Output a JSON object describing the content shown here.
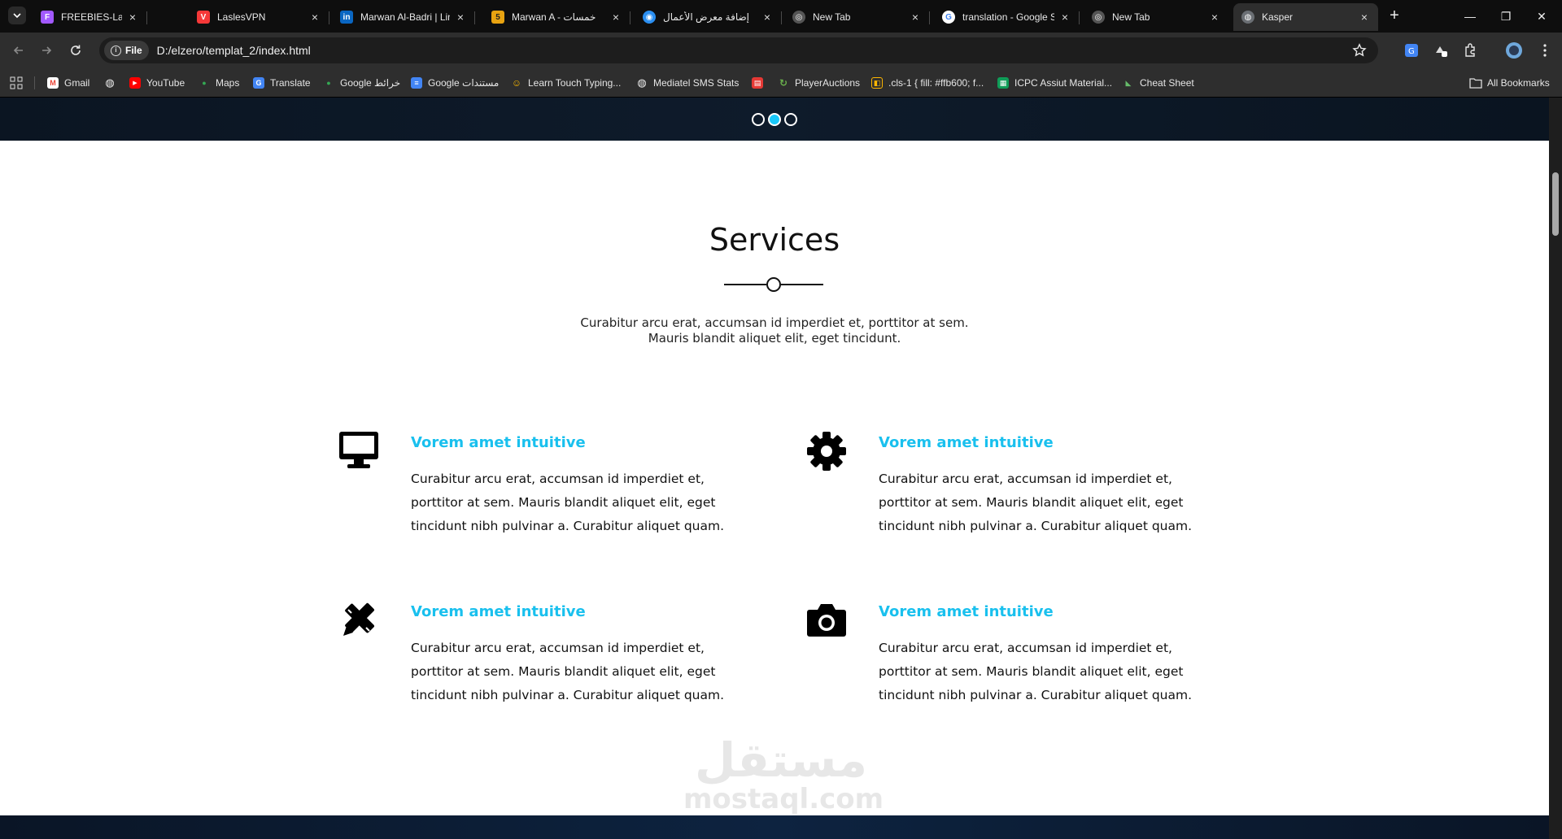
{
  "browser": {
    "tabs": [
      {
        "title": "FREEBIES-Landingpage",
        "favicon": "figma-icon",
        "color": "#a259ff",
        "glyph": "F"
      },
      {
        "title": "LaslesVPN",
        "favicon": "vpn-icon",
        "color": "#f53838",
        "glyph": "V"
      },
      {
        "title": "Marwan Al-Badri | Lin",
        "favicon": "linkedin-icon",
        "color": "#0a66c2",
        "glyph": "in"
      },
      {
        "title": "Marwan A - خمسات",
        "favicon": "khamsat-icon",
        "color": "#e8a311",
        "glyph": "5"
      },
      {
        "title": "إضافة معرض الأعمال",
        "favicon": "mostaql-icon",
        "color": "#2b8ff1",
        "glyph": "◉"
      },
      {
        "title": "New Tab",
        "favicon": "chrome-icon",
        "color": "#cccccc",
        "glyph": "◎"
      },
      {
        "title": "translation - Google S",
        "favicon": "google-icon",
        "color": "#4285f4",
        "glyph": "G"
      },
      {
        "title": "New Tab",
        "favicon": "chrome-icon",
        "color": "#cccccc",
        "glyph": "◎"
      },
      {
        "title": "Kasper",
        "favicon": "globe-icon",
        "color": "#9aa0a6",
        "glyph": "◍"
      }
    ],
    "address": {
      "chip": "File",
      "url": "D:/elzero/templat_2/index.html"
    },
    "bookmarks": [
      {
        "label": "Gmail",
        "icon": "gmail-icon",
        "color": "#ea4335",
        "glyph": "M"
      },
      {
        "label": "",
        "icon": "globe-icon",
        "color": "#e8e8e8",
        "glyph": "◍"
      },
      {
        "label": "YouTube",
        "icon": "youtube-icon",
        "color": "#ff0000",
        "glyph": "▶"
      },
      {
        "label": "Maps",
        "icon": "maps-icon",
        "color": "#34a853",
        "glyph": "●"
      },
      {
        "label": "Translate",
        "icon": "translate-icon",
        "color": "#4285f4",
        "glyph": "G"
      },
      {
        "label": "Google خرائط",
        "icon": "maps-icon",
        "color": "#34a853",
        "glyph": "●"
      },
      {
        "label": "Google مستندات",
        "icon": "docs-icon",
        "color": "#4285f4",
        "glyph": "≡"
      },
      {
        "label": "Learn Touch Typing...",
        "icon": "typing-icon",
        "color": "#f4b400",
        "glyph": "☺"
      },
      {
        "label": "Mediatel SMS Stats",
        "icon": "globe-icon",
        "color": "#e8e8e8",
        "glyph": "◍"
      },
      {
        "label": "",
        "icon": "red-box-icon",
        "color": "#e53935",
        "glyph": "▤"
      },
      {
        "label": "PlayerAuctions",
        "icon": "playerauctions-icon",
        "color": "#6ab04c",
        "glyph": "↻"
      },
      {
        "label": ".cls-1 { fill: #ffb600; f...",
        "icon": "css-icon",
        "color": "#ffb600",
        "glyph": "◧"
      },
      {
        "label": "ICPC Assiut Material...",
        "icon": "sheets-icon",
        "color": "#0f9d58",
        "glyph": "▦"
      },
      {
        "label": "Cheat Sheet",
        "icon": "cheatsheet-icon",
        "color": "#66bb6a",
        "glyph": "◣"
      }
    ],
    "all_bookmarks": "All Bookmarks"
  },
  "page": {
    "slider_bullets": 3,
    "active_bullet": 1,
    "services": {
      "title": "Services",
      "description_line1": "Curabitur arcu erat, accumsan id imperdiet et, porttitor at sem.",
      "description_line2": "Mauris blandit aliquet elit, eget tincidunt.",
      "items": [
        {
          "icon": "desktop-icon",
          "heading": "Vorem amet intuitive",
          "text": "Curabitur arcu erat, accumsan id imperdiet et, porttitor at sem. Mauris blandit aliquet elit, eget tincidunt nibh pulvinar a. Curabitur aliquet quam."
        },
        {
          "icon": "gear-icon",
          "heading": "Vorem amet intuitive",
          "text": "Curabitur arcu erat, accumsan id imperdiet et, porttitor at sem. Mauris blandit aliquet elit, eget tincidunt nibh pulvinar a. Curabitur aliquet quam."
        },
        {
          "icon": "pen-ruler-icon",
          "heading": "Vorem amet intuitive",
          "text": "Curabitur arcu erat, accumsan id imperdiet et, porttitor at sem. Mauris blandit aliquet elit, eget tincidunt nibh pulvinar a. Curabitur aliquet quam."
        },
        {
          "icon": "camera-icon",
          "heading": "Vorem amet intuitive",
          "text": "Curabitur arcu erat, accumsan id imperdiet et, porttitor at sem. Mauris blandit aliquet elit, eget tincidunt nibh pulvinar a. Curabitur aliquet quam."
        }
      ]
    },
    "watermark": {
      "arabic": "مستقل",
      "latin": "mostaql.com"
    },
    "accent_color": "#19c0ee"
  }
}
